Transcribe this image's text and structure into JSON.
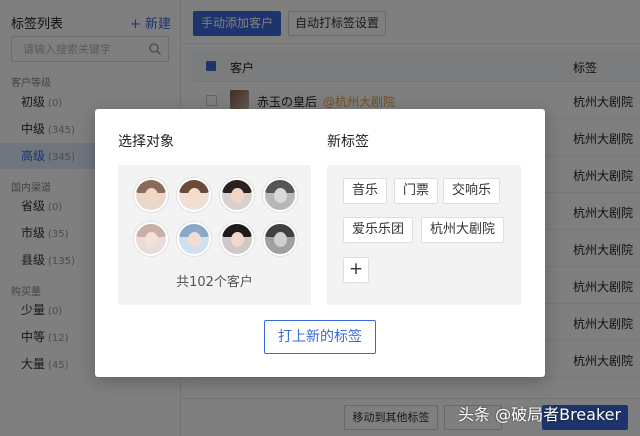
{
  "sidebar": {
    "title": "标签列表",
    "new_label": "+ 新建",
    "search_placeholder": "请输入搜索关键字",
    "groups": [
      {
        "label": "客户等级",
        "items": [
          {
            "label": "初级",
            "count": "(0)"
          },
          {
            "label": "中级",
            "count": "(345)"
          },
          {
            "label": "高级",
            "count": "(345)",
            "active": true
          }
        ]
      },
      {
        "label": "国内渠道",
        "items": [
          {
            "label": "省级",
            "count": "(0)"
          },
          {
            "label": "市级",
            "count": "(35)"
          },
          {
            "label": "县级",
            "count": "(135)"
          }
        ]
      },
      {
        "label": "购买量",
        "items": [
          {
            "label": "少量",
            "count": "(0)"
          },
          {
            "label": "中等",
            "count": "(12)"
          },
          {
            "label": "大量",
            "count": "(45)"
          }
        ]
      }
    ]
  },
  "toolbar": {
    "add_customer": "手动添加客户",
    "auto_tag": "自动打标签设置"
  },
  "table": {
    "col_customer": "客户",
    "col_tag": "标签",
    "rows": [
      {
        "name": "赤玉の皇后",
        "at": "@杭州大剧院",
        "tag": "杭州大剧院"
      },
      {
        "name": "",
        "at": "",
        "tag": "杭州大剧院"
      },
      {
        "name": "",
        "at": "",
        "tag": "杭州大剧院"
      },
      {
        "name": "",
        "at": "",
        "tag": "杭州大剧院"
      },
      {
        "name": "",
        "at": "",
        "tag": "杭州大剧院"
      },
      {
        "name": "",
        "at": "",
        "tag": "杭州大剧院"
      },
      {
        "name": "",
        "at": "",
        "tag": "杭州大剧院"
      },
      {
        "name": "",
        "at": "",
        "tag": "杭州大剧院"
      }
    ]
  },
  "bottom": {
    "move_label": "移动到其他标签"
  },
  "modal": {
    "select_title": "选择对象",
    "new_tag_title": "新标签",
    "count_text": "共102个客户",
    "tags": [
      "音乐",
      "门票",
      "交响乐",
      "爱乐乐团",
      "杭州大剧院"
    ],
    "add_label": "+",
    "submit_label": "打上新的标签"
  },
  "watermark": "头条 @破局者Breaker",
  "colors": {
    "accent": "#3a6ad8",
    "highlight_orange": "#e3a23a",
    "active_bg": "#dfe8fb"
  }
}
